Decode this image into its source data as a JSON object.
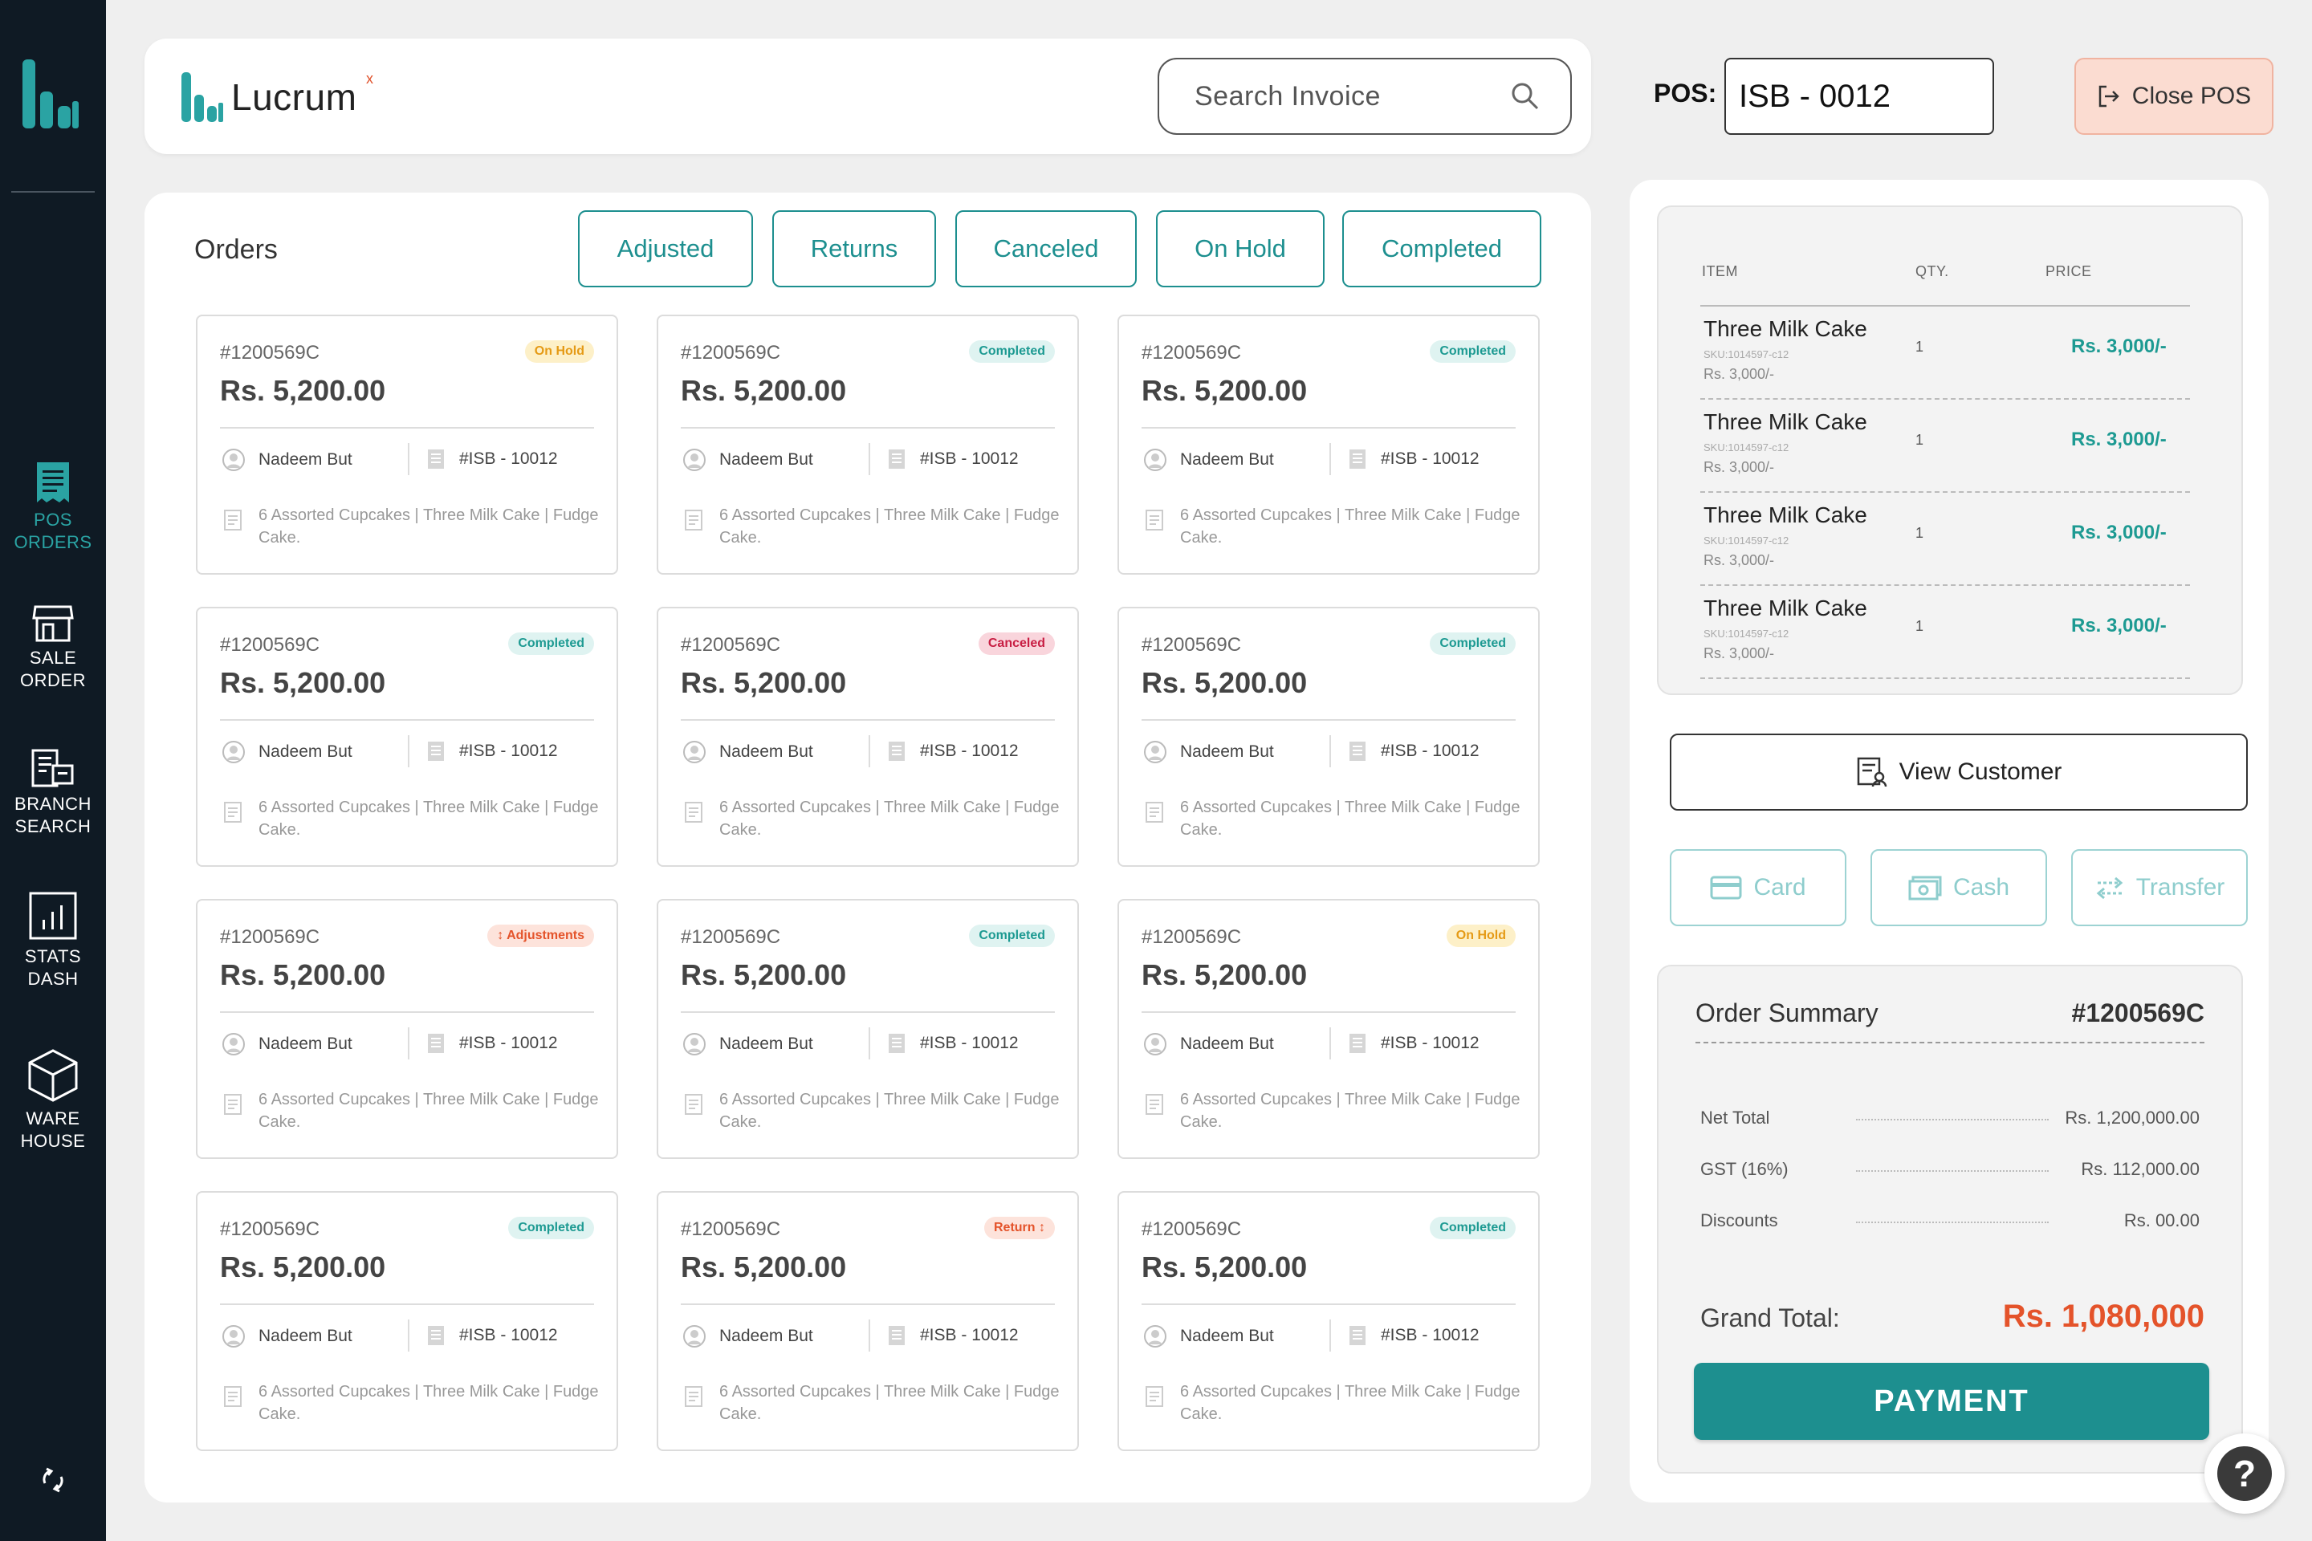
{
  "sidebar": {
    "logo_icon": "lucrum-logo-icon",
    "items": [
      {
        "line1": "POS",
        "line2": "ORDERS",
        "icon": "receipt-icon",
        "active": true
      },
      {
        "line1": "SALE",
        "line2": "ORDER",
        "icon": "store-icon",
        "active": false
      },
      {
        "line1": "BRANCH",
        "line2": "SEARCH",
        "icon": "branch-icon",
        "active": false
      },
      {
        "line1": "STATS",
        "line2": "DASH",
        "icon": "chart-icon",
        "active": false
      },
      {
        "line1": "WARE",
        "line2": "HOUSE",
        "icon": "box-icon",
        "active": false
      }
    ],
    "refresh_icon": "sync-icon"
  },
  "header": {
    "brand": "Lucrum",
    "brand_superscript": "x",
    "search_placeholder": "Search Invoice",
    "pos_label": "POS:",
    "pos_value": "ISB - 0012",
    "close_pos_label": "Close POS"
  },
  "orders": {
    "title": "Orders",
    "filters": [
      "Adjusted",
      "Returns",
      "Canceled",
      "On Hold",
      "Completed"
    ],
    "cards": [
      {
        "id": "#1200569C",
        "amount": "Rs. 5,200.00",
        "status": "On Hold",
        "status_type": "onhold",
        "customer": "Nadeem But",
        "invoice": "#ISB - 10012",
        "items": "6 Assorted Cupcakes | Three Milk Cake | Fudge Cake."
      },
      {
        "id": "#1200569C",
        "amount": "Rs. 5,200.00",
        "status": "Completed",
        "status_type": "completed",
        "customer": "Nadeem But",
        "invoice": "#ISB - 10012",
        "items": "6 Assorted Cupcakes | Three Milk Cake | Fudge Cake."
      },
      {
        "id": "#1200569C",
        "amount": "Rs. 5,200.00",
        "status": "Completed",
        "status_type": "completed",
        "customer": "Nadeem But",
        "invoice": "#ISB - 10012",
        "items": "6 Assorted Cupcakes | Three Milk Cake | Fudge Cake."
      },
      {
        "id": "#1200569C",
        "amount": "Rs. 5,200.00",
        "status": "Completed",
        "status_type": "completed",
        "customer": "Nadeem But",
        "invoice": "#ISB - 10012",
        "items": "6 Assorted Cupcakes | Three Milk Cake | Fudge Cake."
      },
      {
        "id": "#1200569C",
        "amount": "Rs. 5,200.00",
        "status": "Canceled",
        "status_type": "canceled",
        "customer": "Nadeem But",
        "invoice": "#ISB - 10012",
        "items": "6 Assorted Cupcakes | Three Milk Cake | Fudge Cake."
      },
      {
        "id": "#1200569C",
        "amount": "Rs. 5,200.00",
        "status": "Completed",
        "status_type": "completed",
        "customer": "Nadeem But",
        "invoice": "#ISB - 10012",
        "items": "6 Assorted Cupcakes | Three Milk Cake | Fudge Cake."
      },
      {
        "id": "#1200569C",
        "amount": "Rs. 5,200.00",
        "status": "↕ Adjustments",
        "status_type": "adjust",
        "customer": "Nadeem But",
        "invoice": "#ISB - 10012",
        "items": "6 Assorted Cupcakes | Three Milk Cake | Fudge Cake."
      },
      {
        "id": "#1200569C",
        "amount": "Rs. 5,200.00",
        "status": "Completed",
        "status_type": "completed",
        "customer": "Nadeem But",
        "invoice": "#ISB - 10012",
        "items": "6 Assorted Cupcakes | Three Milk Cake | Fudge Cake."
      },
      {
        "id": "#1200569C",
        "amount": "Rs. 5,200.00",
        "status": "On Hold",
        "status_type": "onhold",
        "customer": "Nadeem But",
        "invoice": "#ISB - 10012",
        "items": "6 Assorted Cupcakes | Three Milk Cake | Fudge Cake."
      },
      {
        "id": "#1200569C",
        "amount": "Rs. 5,200.00",
        "status": "Completed",
        "status_type": "completed",
        "customer": "Nadeem But",
        "invoice": "#ISB - 10012",
        "items": "6 Assorted Cupcakes | Three Milk Cake | Fudge Cake."
      },
      {
        "id": "#1200569C",
        "amount": "Rs. 5,200.00",
        "status": "Return ↕",
        "status_type": "return",
        "customer": "Nadeem But",
        "invoice": "#ISB - 10012",
        "items": "6 Assorted Cupcakes | Three Milk Cake | Fudge Cake."
      },
      {
        "id": "#1200569C",
        "amount": "Rs. 5,200.00",
        "status": "Completed",
        "status_type": "completed",
        "customer": "Nadeem But",
        "invoice": "#ISB - 10012",
        "items": "6 Assorted Cupcakes | Three Milk Cake | Fudge Cake."
      }
    ]
  },
  "cart": {
    "headers": {
      "item": "ITEM",
      "qty": "QTY.",
      "price": "PRICE"
    },
    "items": [
      {
        "name": "Three Milk Cake",
        "sku": "SKU:1014597-c12",
        "unit": "Rs. 3,000/-",
        "qty": "1",
        "price": "Rs. 3,000/-"
      },
      {
        "name": "Three Milk Cake",
        "sku": "SKU:1014597-c12",
        "unit": "Rs. 3,000/-",
        "qty": "1",
        "price": "Rs. 3,000/-"
      },
      {
        "name": "Three Milk Cake",
        "sku": "SKU:1014597-c12",
        "unit": "Rs. 3,000/-",
        "qty": "1",
        "price": "Rs. 3,000/-"
      },
      {
        "name": "Three Milk Cake",
        "sku": "SKU:1014597-c12",
        "unit": "Rs. 3,000/-",
        "qty": "1",
        "price": "Rs. 3,000/-"
      }
    ],
    "view_customer_label": "View Customer",
    "payment_methods": [
      {
        "label": "Card",
        "icon": "card-icon"
      },
      {
        "label": "Cash",
        "icon": "cash-icon"
      },
      {
        "label": "Transfer",
        "icon": "transfer-icon"
      }
    ]
  },
  "summary": {
    "title": "Order Summary",
    "order_id": "#1200569C",
    "rows": [
      {
        "label": "Net Total",
        "value": "Rs. 1,200,000.00"
      },
      {
        "label": "GST (16%)",
        "value": "Rs. 112,000.00"
      },
      {
        "label": "Discounts",
        "value": "Rs. 00.00"
      }
    ],
    "grand_total_label": "Grand Total:",
    "grand_total_value": "Rs. 1,080,000",
    "payment_label": "PAYMENT"
  },
  "help_label": "?",
  "colors": {
    "accent": "#1d8f8f",
    "sidebar_bg": "#0f1a24",
    "grand_total": "#e4532a"
  }
}
